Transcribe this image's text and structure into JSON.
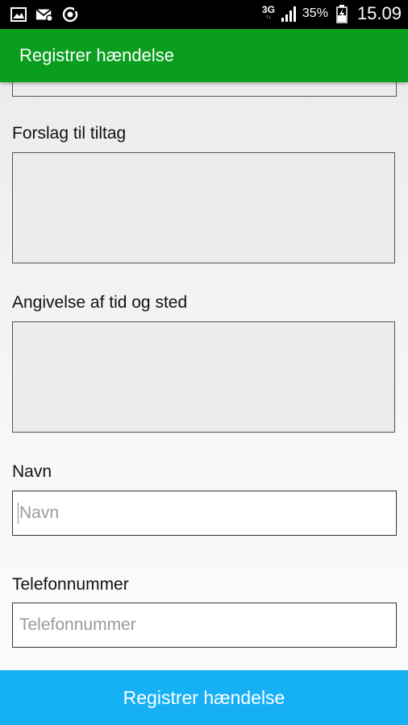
{
  "status_bar": {
    "network_type": "3G",
    "battery_percent": "35%",
    "time": "15.09",
    "icons": [
      "gallery-icon",
      "sms-icon",
      "sync-icon",
      "signal-icon",
      "battery-icon"
    ]
  },
  "app_bar": {
    "title": "Registrer hændelse"
  },
  "form": {
    "suggestion_label": "Forslag til tiltag",
    "time_place_label": "Angivelse af tid og sted",
    "name_label": "Navn",
    "name_placeholder": "Navn",
    "phone_label": "Telefonnummer",
    "phone_placeholder": "Telefonnummer"
  },
  "submit": {
    "label": "Registrer hændelse"
  },
  "colors": {
    "app_bar": "#0a9e1f",
    "submit_button": "#16b0f5",
    "status_bar": "#000000"
  }
}
